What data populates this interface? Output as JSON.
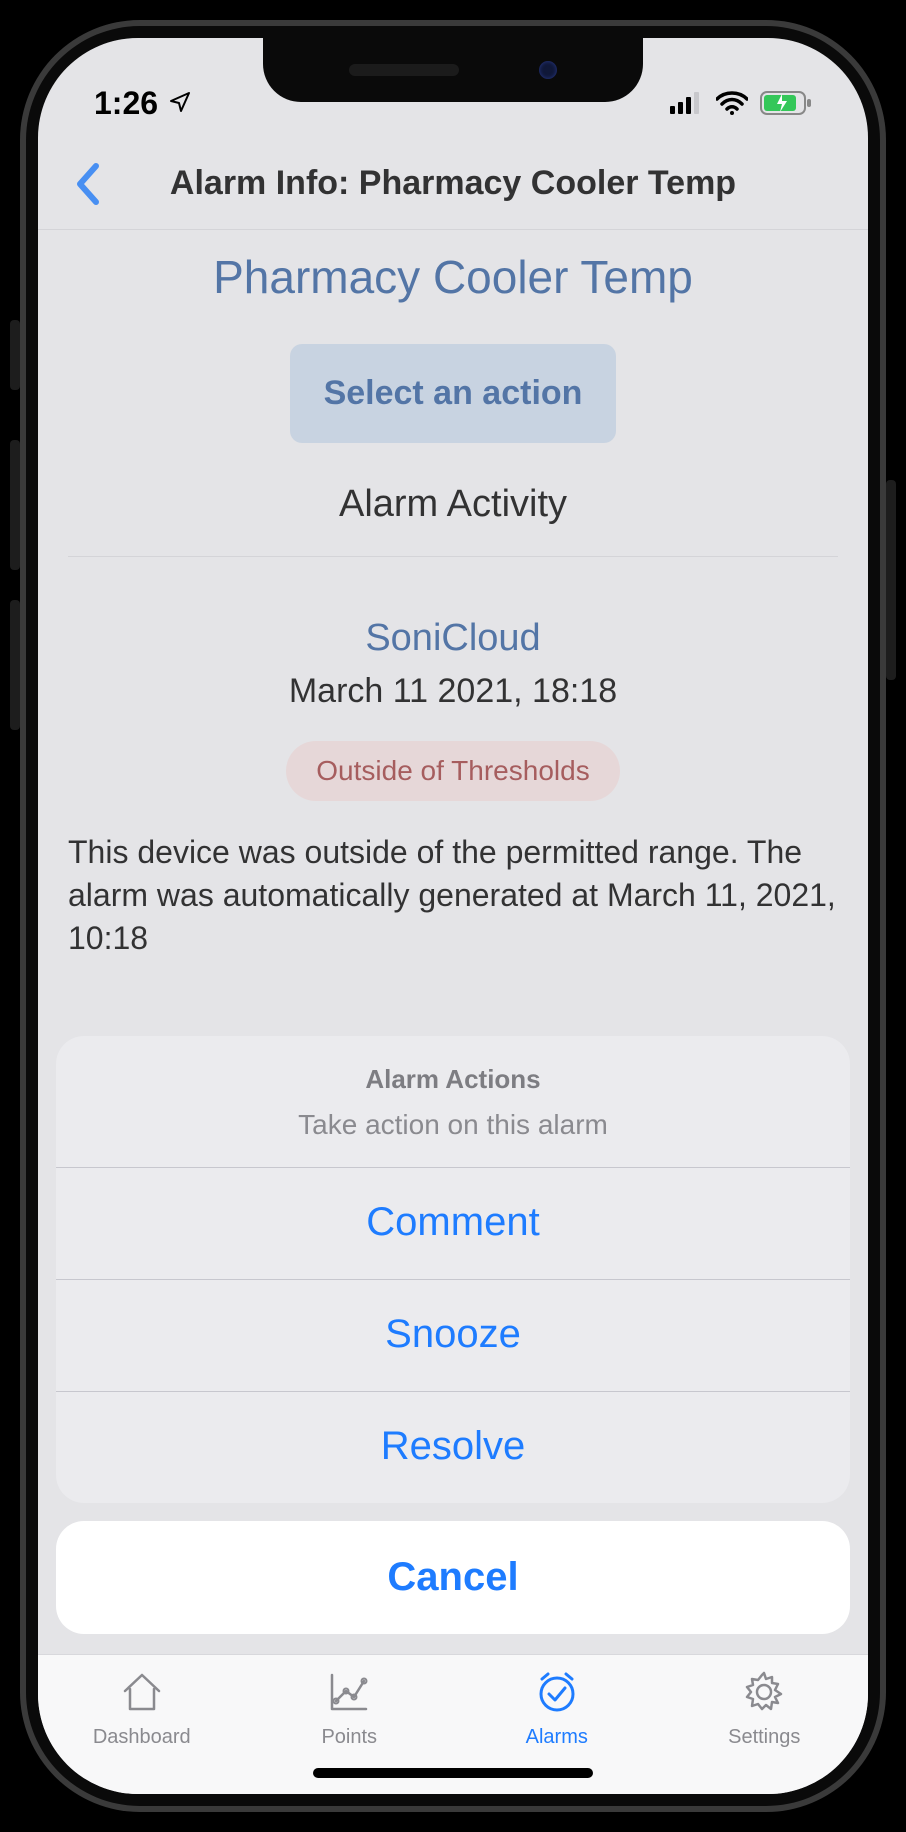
{
  "status": {
    "time": "1:26"
  },
  "header": {
    "title": "Alarm Info: Pharmacy Cooler Temp"
  },
  "sensor": {
    "name": "Pharmacy Cooler Temp"
  },
  "select_action_label": "Select an action",
  "activity_heading": "Alarm Activity",
  "event": {
    "source": "SoniCloud",
    "timestamp": "March 11 2021, 18:18",
    "badge": "Outside of Thresholds",
    "body": "This device was outside of the permitted range. The alarm was automatically generated at March 11, 2021, 10:18"
  },
  "action_sheet": {
    "title": "Alarm Actions",
    "subtitle": "Take action on this alarm",
    "options": [
      "Comment",
      "Snooze",
      "Resolve"
    ],
    "cancel": "Cancel"
  },
  "tabs": {
    "dashboard": "Dashboard",
    "points": "Points",
    "alarms": "Alarms",
    "settings": "Settings"
  }
}
